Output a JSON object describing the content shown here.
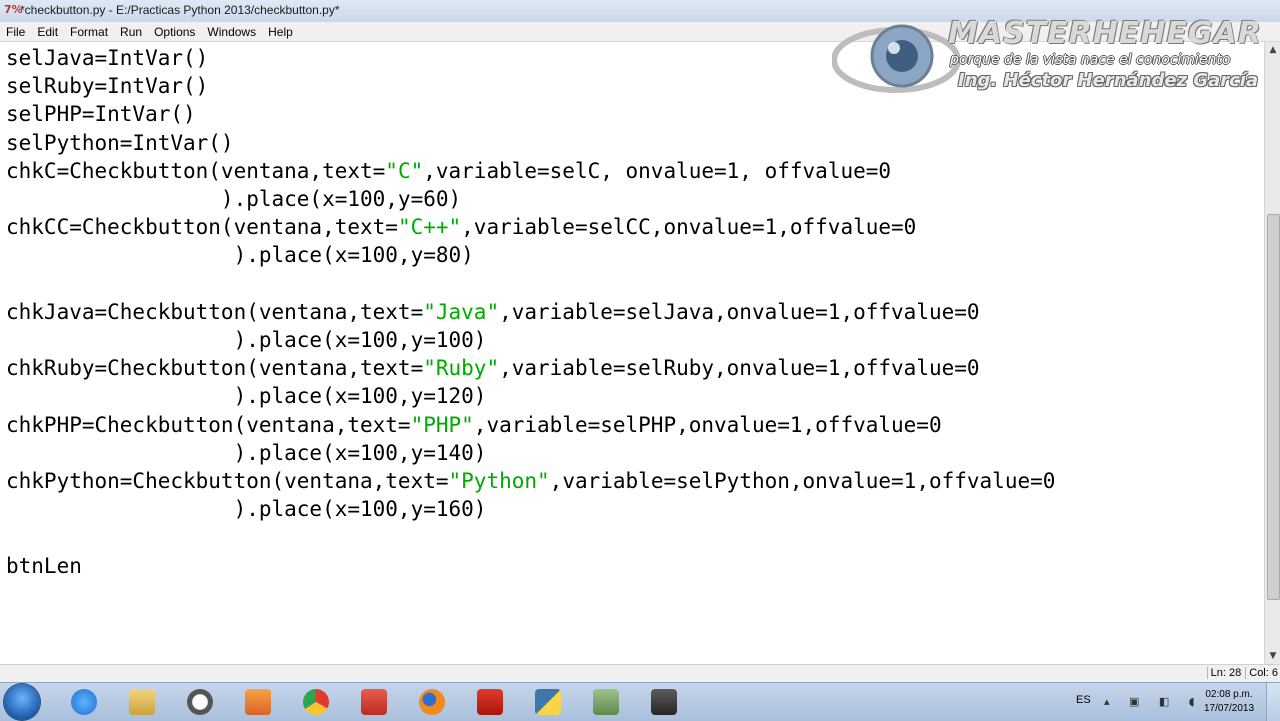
{
  "window": {
    "title": "*checkbutton.py - E:/Practicas Python 2013/checkbutton.py*"
  },
  "menu": [
    "File",
    "Edit",
    "Format",
    "Run",
    "Options",
    "Windows",
    "Help"
  ],
  "watermark": {
    "brand": "MASTERHEHEGAR",
    "tagline": "porque de la vista nace el conocimiento",
    "author": "Ing. Héctor Hernández García"
  },
  "code": {
    "lines": [
      {
        "parts": [
          {
            "t": "selJava=IntVar()"
          }
        ]
      },
      {
        "parts": [
          {
            "t": "selRuby=IntVar()"
          }
        ]
      },
      {
        "parts": [
          {
            "t": "selPHP=IntVar()"
          }
        ]
      },
      {
        "parts": [
          {
            "t": "selPython=IntVar()"
          }
        ]
      },
      {
        "parts": [
          {
            "t": "chkC=Checkbutton(ventana,text="
          },
          {
            "t": "\"C\"",
            "s": true
          },
          {
            "t": ",variable=selC, onvalue=1, offvalue=0"
          }
        ]
      },
      {
        "parts": [
          {
            "t": "                 ).place(x=100,y=60)"
          }
        ]
      },
      {
        "parts": [
          {
            "t": "chkCC=Checkbutton(ventana,text="
          },
          {
            "t": "\"C++\"",
            "s": true
          },
          {
            "t": ",variable=selCC,onvalue=1,offvalue=0"
          }
        ]
      },
      {
        "parts": [
          {
            "t": "                  ).place(x=100,y=80)"
          }
        ]
      },
      {
        "parts": [
          {
            "t": ""
          }
        ]
      },
      {
        "parts": [
          {
            "t": "chkJava=Checkbutton(ventana,text="
          },
          {
            "t": "\"Java\"",
            "s": true
          },
          {
            "t": ",variable=selJava,onvalue=1,offvalue=0"
          }
        ]
      },
      {
        "parts": [
          {
            "t": "                  ).place(x=100,y=100)"
          }
        ]
      },
      {
        "parts": [
          {
            "t": "chkRuby=Checkbutton(ventana,text="
          },
          {
            "t": "\"Ruby\"",
            "s": true
          },
          {
            "t": ",variable=selRuby,onvalue=1,offvalue=0"
          }
        ]
      },
      {
        "parts": [
          {
            "t": "                  ).place(x=100,y=120)"
          }
        ]
      },
      {
        "parts": [
          {
            "t": "chkPHP=Checkbutton(ventana,text="
          },
          {
            "t": "\"PHP\"",
            "s": true
          },
          {
            "t": ",variable=selPHP,onvalue=1,offvalue=0"
          }
        ]
      },
      {
        "parts": [
          {
            "t": "                  ).place(x=100,y=140)"
          }
        ]
      },
      {
        "parts": [
          {
            "t": "chkPython=Checkbutton(ventana,text="
          },
          {
            "t": "\"Python\"",
            "s": true
          },
          {
            "t": ",variable=selPython,onvalue=1,offvalue=0"
          }
        ]
      },
      {
        "parts": [
          {
            "t": "                  ).place(x=100,y=160)"
          }
        ]
      },
      {
        "parts": [
          {
            "t": ""
          }
        ]
      },
      {
        "parts": [
          {
            "t": "btnLen"
          }
        ]
      }
    ]
  },
  "status": {
    "line": "Ln: 28",
    "col": "Col: 6"
  },
  "taskbar": {
    "apps": [
      "internet-explorer-icon",
      "file-explorer-icon",
      "clock-app-icon",
      "media-player-icon",
      "chrome-icon",
      "bookmark-app-icon",
      "firefox-icon",
      "pdf-reader-icon",
      "python-icon",
      "notes-icon",
      "video-camera-icon"
    ],
    "language": "ES",
    "time": "02:08 p.m.",
    "date": "17/07/2013"
  },
  "colors": {
    "string": "#00aa00",
    "text": "#000000"
  }
}
